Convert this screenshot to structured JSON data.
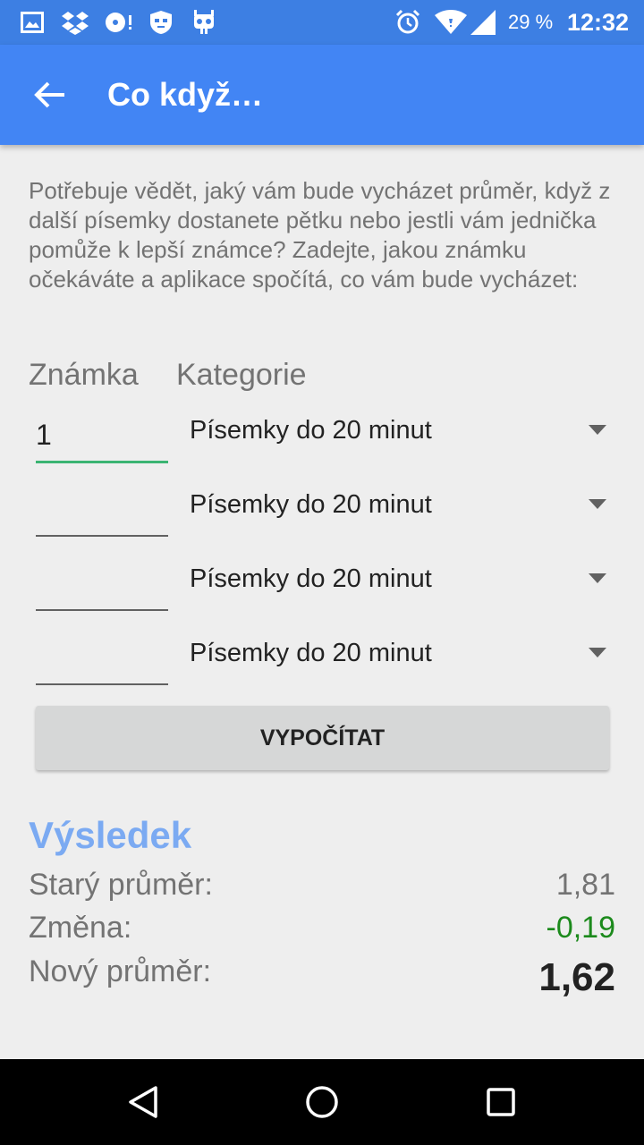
{
  "status_bar": {
    "battery": "29 %",
    "time": "12:32",
    "icons": [
      "image-icon",
      "dropbox-icon",
      "disc-alert-icon",
      "shield-face-icon",
      "robot-icon",
      "alarm-icon",
      "wifi-icon",
      "signal-icon"
    ]
  },
  "app_bar": {
    "title": "Co když…",
    "back_icon": "arrow-back-icon"
  },
  "description": "Potřebuje vědět, jaký vám bude vycházet průměr, když z další písemky dostanete pětku nebo jestli vám jednička pomůže k lepší známce? Zadejte, jakou známku očekáváte a aplikace spočítá, co vám bude vycházet:",
  "columns": {
    "grade": "Známka",
    "category": "Kategorie"
  },
  "rows": [
    {
      "grade": "1",
      "category": "Písemky do 20 minut"
    },
    {
      "grade": "",
      "category": "Písemky do 20 minut"
    },
    {
      "grade": "",
      "category": "Písemky do 20 minut"
    },
    {
      "grade": "",
      "category": "Písemky do 20 minut"
    }
  ],
  "calculate_button": "VYPOČÍTAT",
  "result": {
    "title": "Výsledek",
    "old_label": "Starý průměr:",
    "old_value": "1,81",
    "change_label": "Změna:",
    "change_value": "-0,19",
    "new_label": "Nový průměr:",
    "new_value": "1,62"
  },
  "colors": {
    "status_bar": "#3d7fe3",
    "app_bar": "#4285f4",
    "accent_title": "#7baaf2",
    "focus_underline": "#3bb472",
    "change_positive": "#1c8a1c"
  },
  "nav_bar": {
    "icons": [
      "back-triangle-icon",
      "home-circle-icon",
      "recents-square-icon"
    ]
  }
}
